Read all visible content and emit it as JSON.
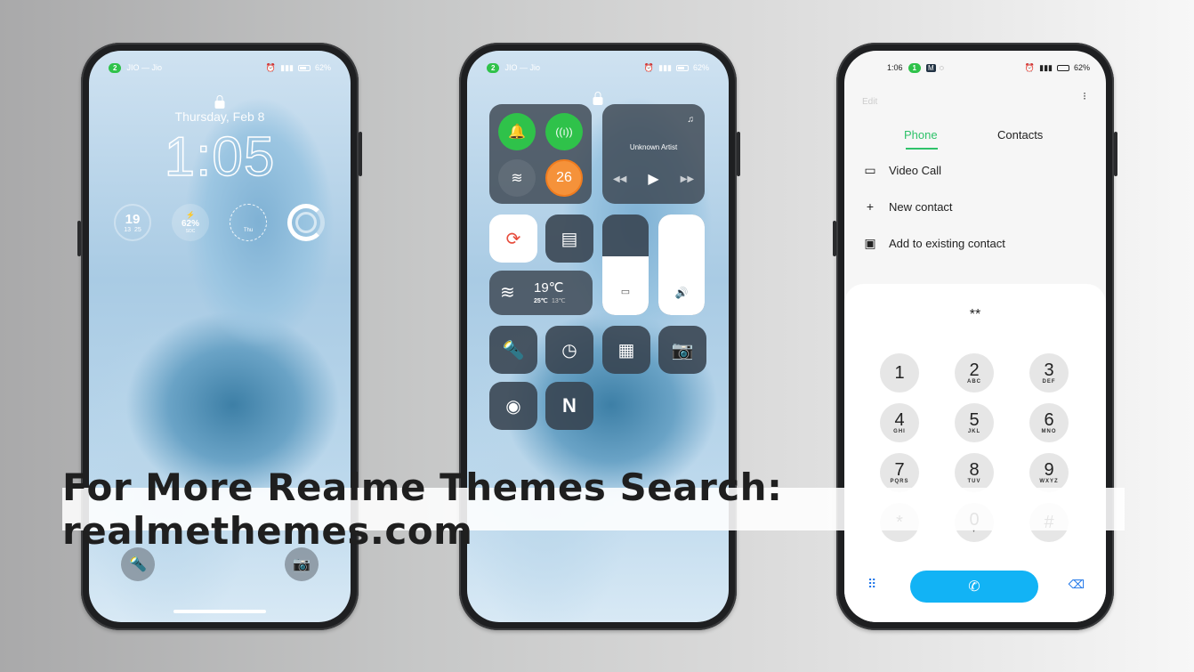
{
  "banner": {
    "text": "For More Realme Themes Search: realmethemes.com"
  },
  "lockscreen": {
    "status": {
      "carrier_pill": "2",
      "carrier": "JIO — Jio",
      "battery": "62%"
    },
    "date": "Thursday, Feb 8",
    "time": "1:05",
    "widgets": {
      "weather_temp": "19",
      "weather_low": "13",
      "weather_high": "25",
      "battery_pct": "62%",
      "battery_label": "SOC",
      "clock_day": "Thu"
    },
    "icons": {
      "flashlight": "flashlight-icon",
      "camera": "camera-icon"
    }
  },
  "control_center": {
    "status": {
      "carrier_pill": "2",
      "carrier": "JIO — Jio",
      "battery": "62%"
    },
    "media": {
      "artist": "Unknown Artist"
    },
    "toggles": {
      "brightness_value": "26"
    },
    "weather": {
      "temp": "19℃",
      "high": "25℃",
      "low": "13℃"
    },
    "brightness_level": 0.58,
    "volume_level": 1.0
  },
  "dialer": {
    "status": {
      "time": "1:06",
      "pill": "1",
      "battery": "62%"
    },
    "edit_label": "Edit",
    "tabs": [
      {
        "label": "Phone",
        "active": true
      },
      {
        "label": "Contacts",
        "active": false
      }
    ],
    "menu": [
      {
        "icon": "video-call-icon",
        "label": "Video Call"
      },
      {
        "icon": "plus-icon",
        "label": "New contact"
      },
      {
        "icon": "save-icon",
        "label": "Add to existing contact"
      }
    ],
    "entered": "**",
    "keys": [
      {
        "n": "1",
        "l": ""
      },
      {
        "n": "2",
        "l": "ABC"
      },
      {
        "n": "3",
        "l": "DEF"
      },
      {
        "n": "4",
        "l": "GHI"
      },
      {
        "n": "5",
        "l": "JKL"
      },
      {
        "n": "6",
        "l": "MNO"
      },
      {
        "n": "7",
        "l": "PQRS"
      },
      {
        "n": "8",
        "l": "TUV"
      },
      {
        "n": "9",
        "l": "WXYZ"
      },
      {
        "n": "*",
        "l": ""
      },
      {
        "n": "0",
        "l": "+"
      },
      {
        "n": "#",
        "l": ""
      }
    ],
    "colors": {
      "accent": "#2fc26a",
      "call": "#12b3f5"
    }
  }
}
